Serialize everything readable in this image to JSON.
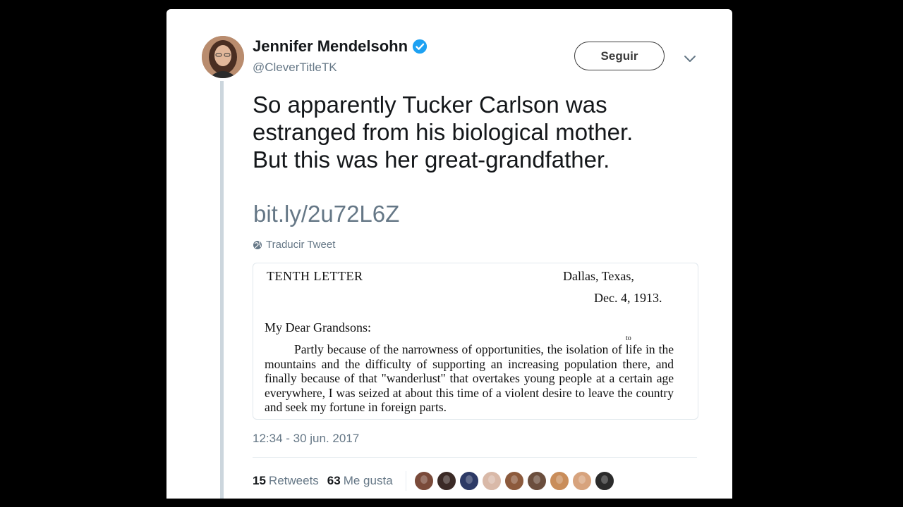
{
  "tweet": {
    "author_name": "Jennifer Mendelsohn",
    "handle": "@CleverTitleTK",
    "follow_label": "Seguir",
    "text_lines": [
      "So apparently Tucker Carlson was",
      "estranged from his biological mother.",
      "But this was her great-grandfather."
    ],
    "link": "bit.ly/2u72L6Z",
    "translate_label": "Traducir Tweet",
    "timestamp": "12:34 - 30 jun. 2017",
    "retweets_count": "15",
    "retweets_label": "Retweets",
    "likes_count": "63",
    "likes_label": "Me gusta"
  },
  "letter": {
    "title": "TENTH LETTER",
    "place": "Dallas, Texas,",
    "date": "Dec. 4, 1913.",
    "salutation": "My Dear Grandsons:",
    "insert": "to",
    "body": "Partly because of the narrowness of opportunities, the isolation of life in the mountains and the difficulty of supporting an increasing population there, and finally because of that \"wanderlust\" that overtakes young people at a certain age everywhere, I was seized at about this time of a violent desire to leave the country and seek my fortune in foreign parts."
  },
  "icons": {
    "verified": "verified-badge-icon",
    "chevron": "chevron-down-icon",
    "globe": "globe-icon"
  },
  "colors": {
    "verified_blue": "#1da1f2",
    "secondary_text": "#657786",
    "primary_text": "#14171a",
    "thread_line": "#ccd6dd"
  },
  "likers_avatar_colors": [
    "#7a4a3a",
    "#3b2a26",
    "#2d3a66",
    "#d9b9a8",
    "#8c5a3c",
    "#6b4e3d",
    "#c98d5a",
    "#d7a37d",
    "#2b2b2b"
  ]
}
